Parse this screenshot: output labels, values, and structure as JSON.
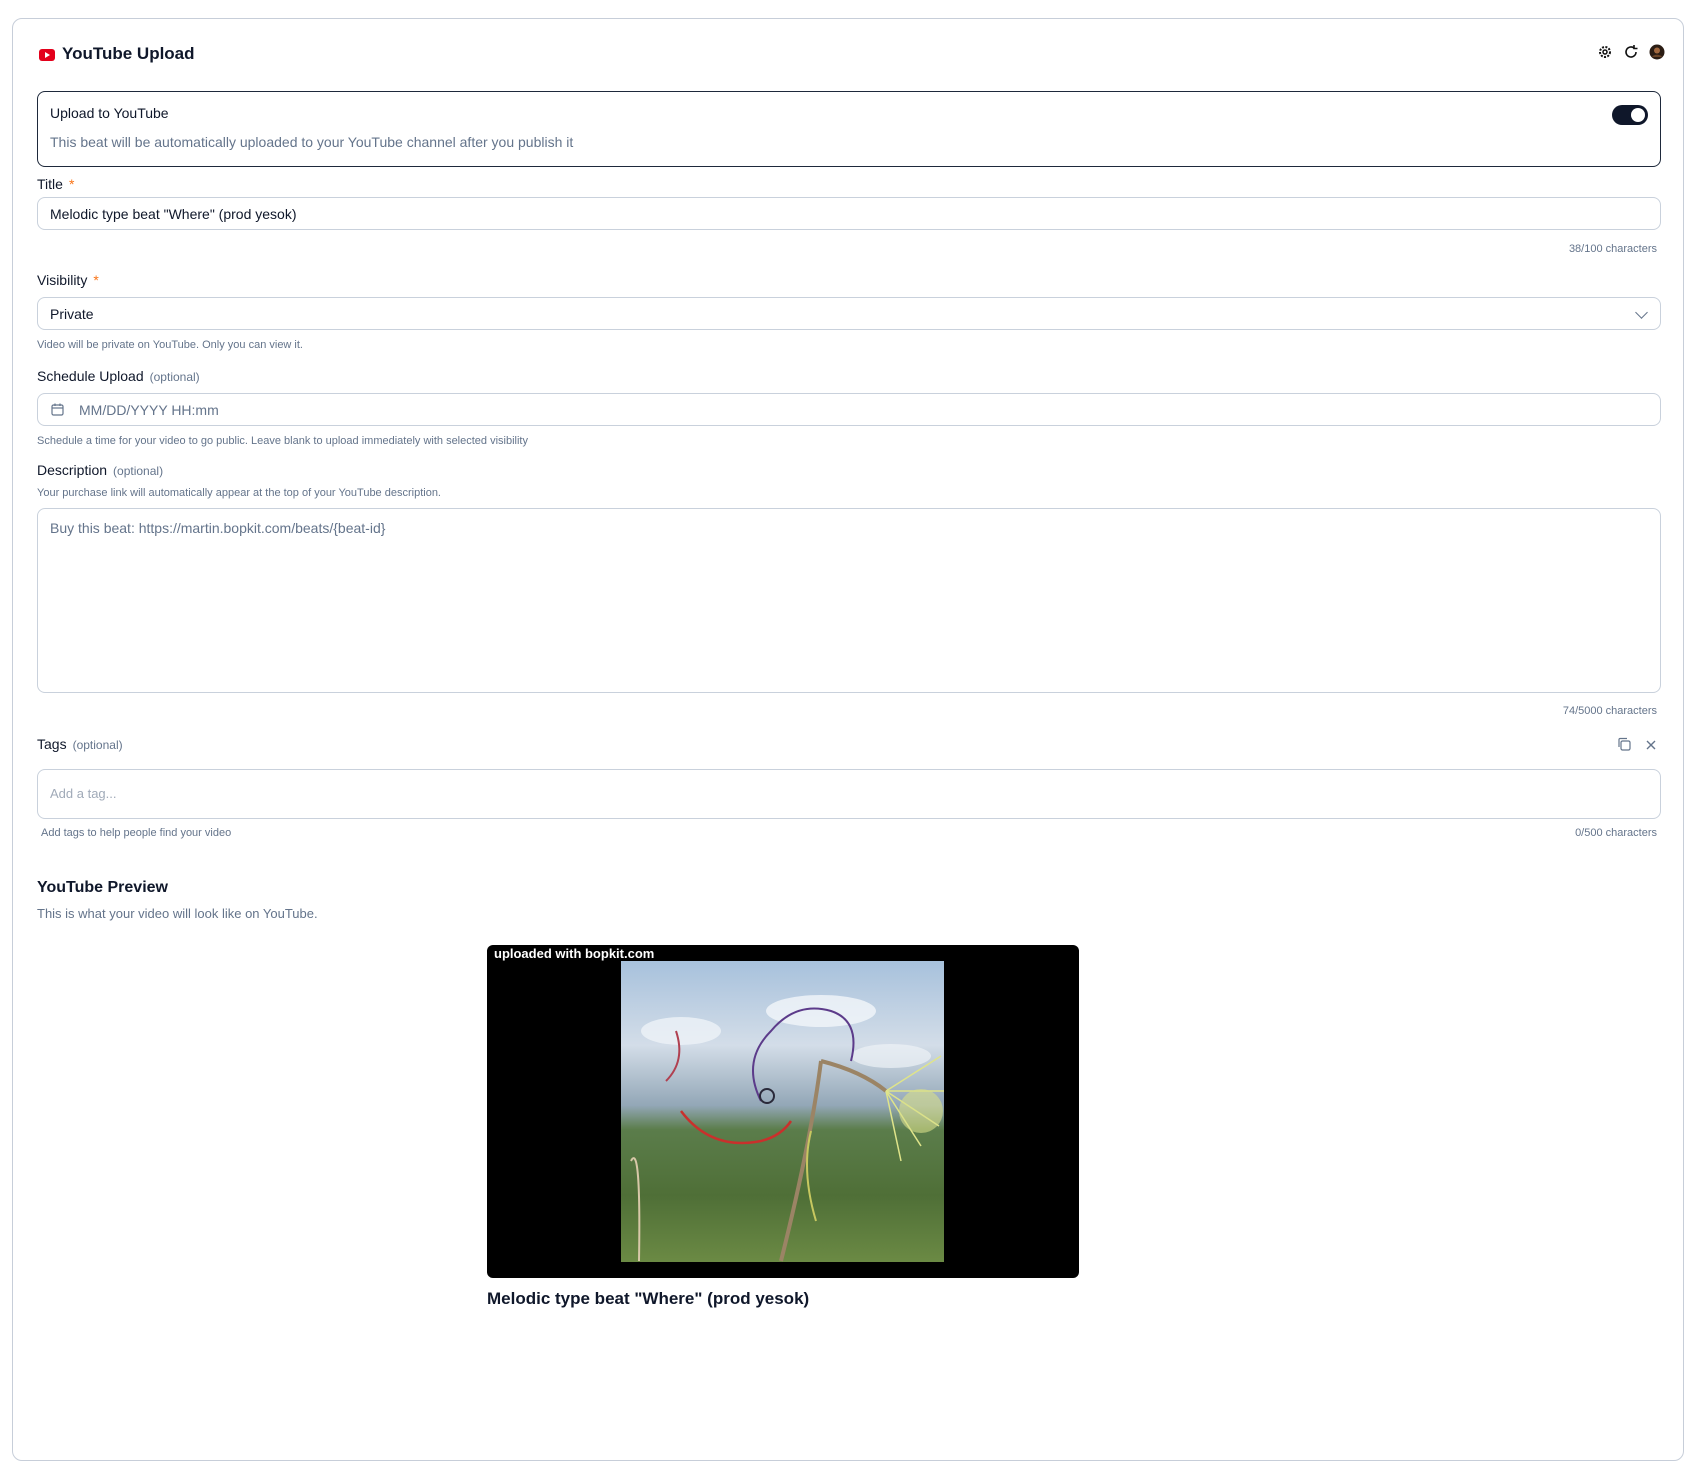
{
  "header": {
    "title": "YouTube Upload"
  },
  "upload_toggle": {
    "title": "Upload to YouTube",
    "description": "This beat will be automatically uploaded to your YouTube channel after you publish it",
    "enabled": true
  },
  "title_field": {
    "label": "Title",
    "required_mark": "*",
    "value": "Melodic type beat \"Where\" (prod yesok)",
    "counter": "38/100 characters"
  },
  "visibility": {
    "label": "Visibility",
    "required_mark": "*",
    "value": "Private",
    "help": "Video will be private on YouTube. Only you can view it."
  },
  "schedule": {
    "label": "Schedule Upload",
    "optional": "(optional)",
    "placeholder": "MM/DD/YYYY HH:mm",
    "help": "Schedule a time for your video to go public. Leave blank to upload immediately with selected visibility"
  },
  "description": {
    "label": "Description",
    "optional": "(optional)",
    "help": "Your purchase link will automatically appear at the top of your YouTube description.",
    "value": "Buy this beat: https://martin.bopkit.com/beats/{beat-id}",
    "counter": "74/5000 characters"
  },
  "tags": {
    "label": "Tags",
    "optional": "(optional)",
    "placeholder": "Add a tag...",
    "help": "Add tags to help people find your video",
    "counter": "0/500 characters"
  },
  "preview": {
    "title": "YouTube Preview",
    "subtitle": "This is what your video will look like on YouTube.",
    "watermark": "uploaded with bopkit.com",
    "video_title": "Melodic type beat \"Where\" (prod yesok)"
  },
  "colors": {
    "accent": "#0f172a",
    "youtube_red": "#e3001b",
    "required": "#f97316"
  }
}
